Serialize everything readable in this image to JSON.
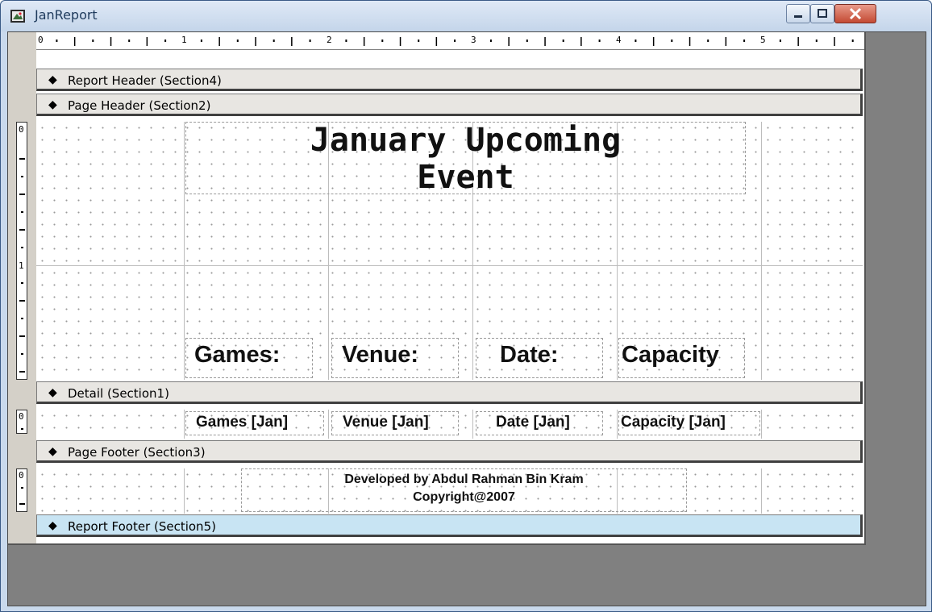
{
  "window": {
    "title": "JanReport",
    "controls": [
      "minimize",
      "maximize",
      "close"
    ]
  },
  "ruler": {
    "numbers": [
      "0",
      "1",
      "2",
      "3",
      "4",
      "5"
    ],
    "vertical_numbers": [
      "0",
      "1"
    ]
  },
  "sections": {
    "report_header": "Report Header (Section4)",
    "page_header": "Page Header (Section2)",
    "detail": "Detail (Section1)",
    "page_footer": "Page Footer (Section3)",
    "report_footer": "Report Footer (Section5)"
  },
  "page_header": {
    "title_line1": "January Upcoming",
    "title_line2": "Event",
    "col_games": "Games:",
    "col_venue": "Venue:",
    "col_date": "Date:",
    "col_capacity": "Capacity"
  },
  "detail": {
    "games": "Games [Jan]",
    "venue": "Venue [Jan]",
    "date": "Date [Jan]",
    "capacity": "Capacity [Jan]"
  },
  "footer": {
    "developer": "Developed by Abdul Rahman Bin Kram",
    "copyright": "Copyright@2007"
  },
  "colors": {
    "active_section": "#c8e4f3",
    "section_bar": "#e8e6e2",
    "client_bg": "#808080"
  }
}
